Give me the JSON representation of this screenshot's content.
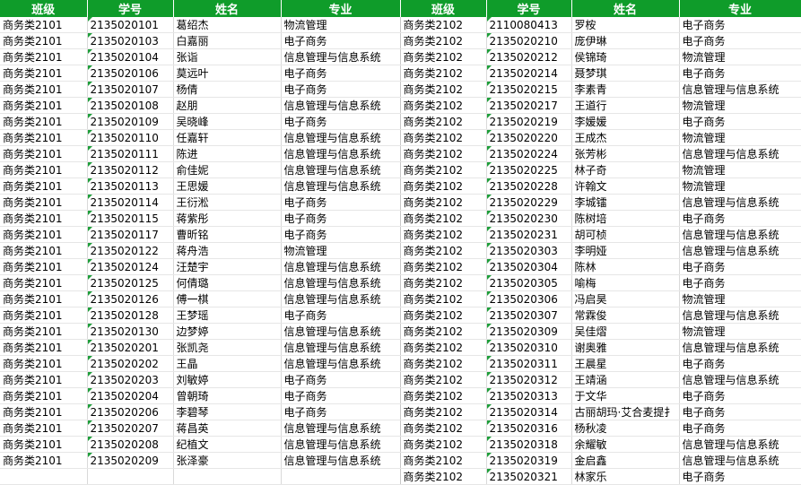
{
  "headers": [
    "班级",
    "学号",
    "姓名",
    "专业",
    "班级",
    "学号",
    "姓名",
    "专业"
  ],
  "colors": {
    "header_bg": "#0f9c2a",
    "header_text": "#ffffff",
    "id_marker": "#1e9e3a"
  },
  "rows": [
    [
      "商务类2101",
      "2135020101",
      "葛绍杰",
      "物流管理",
      "商务类2102",
      "2110080413",
      "罗桉",
      "电子商务"
    ],
    [
      "商务类2101",
      "2135020103",
      "白嘉丽",
      "电子商务",
      "商务类2102",
      "2135020210",
      "庞伊琳",
      "电子商务"
    ],
    [
      "商务类2101",
      "2135020104",
      "张诣",
      "信息管理与信息系统",
      "商务类2102",
      "2135020212",
      "侯锦琦",
      "物流管理"
    ],
    [
      "商务类2101",
      "2135020106",
      "莫远叶",
      "电子商务",
      "商务类2102",
      "2135020214",
      "聂梦琪",
      "电子商务"
    ],
    [
      "商务类2101",
      "2135020107",
      "杨倩",
      "电子商务",
      "商务类2102",
      "2135020215",
      "李素青",
      "信息管理与信息系统"
    ],
    [
      "商务类2101",
      "2135020108",
      "赵朋",
      "信息管理与信息系统",
      "商务类2102",
      "2135020217",
      "王道行",
      "物流管理"
    ],
    [
      "商务类2101",
      "2135020109",
      "吴晓峰",
      "电子商务",
      "商务类2102",
      "2135020219",
      "李媛媛",
      "电子商务"
    ],
    [
      "商务类2101",
      "2135020110",
      "任嘉轩",
      "信息管理与信息系统",
      "商务类2102",
      "2135020220",
      "王成杰",
      "物流管理"
    ],
    [
      "商务类2101",
      "2135020111",
      "陈进",
      "信息管理与信息系统",
      "商务类2102",
      "2135020224",
      "张芳彬",
      "信息管理与信息系统"
    ],
    [
      "商务类2101",
      "2135020112",
      "俞佳妮",
      "信息管理与信息系统",
      "商务类2102",
      "2135020225",
      "林子奇",
      "物流管理"
    ],
    [
      "商务类2101",
      "2135020113",
      "王思媛",
      "信息管理与信息系统",
      "商务类2102",
      "2135020228",
      "许翰文",
      "物流管理"
    ],
    [
      "商务类2101",
      "2135020114",
      "王衍淞",
      "电子商务",
      "商务类2102",
      "2135020229",
      "李城镭",
      "信息管理与信息系统"
    ],
    [
      "商务类2101",
      "2135020115",
      "蒋紫彤",
      "电子商务",
      "商务类2102",
      "2135020230",
      "陈树培",
      "电子商务"
    ],
    [
      "商务类2101",
      "2135020117",
      "曹昕铭",
      "电子商务",
      "商务类2102",
      "2135020231",
      "胡可桢",
      "信息管理与信息系统"
    ],
    [
      "商务类2101",
      "2135020122",
      "蒋舟浩",
      "物流管理",
      "商务类2102",
      "2135020303",
      "李明娅",
      "信息管理与信息系统"
    ],
    [
      "商务类2101",
      "2135020124",
      "汪楚宇",
      "信息管理与信息系统",
      "商务类2102",
      "2135020304",
      "陈林",
      "电子商务"
    ],
    [
      "商务类2101",
      "2135020125",
      "何倩璐",
      "信息管理与信息系统",
      "商务类2102",
      "2135020305",
      "喻梅",
      "电子商务"
    ],
    [
      "商务类2101",
      "2135020126",
      "傅一棋",
      "信息管理与信息系统",
      "商务类2102",
      "2135020306",
      "冯启昊",
      "物流管理"
    ],
    [
      "商务类2101",
      "2135020128",
      "王梦瑶",
      "电子商务",
      "商务类2102",
      "2135020307",
      "常霖俊",
      "信息管理与信息系统"
    ],
    [
      "商务类2101",
      "2135020130",
      "边梦婷",
      "信息管理与信息系统",
      "商务类2102",
      "2135020309",
      "吴佳熠",
      "物流管理"
    ],
    [
      "商务类2101",
      "2135020201",
      "张凯尧",
      "信息管理与信息系统",
      "商务类2102",
      "2135020310",
      "谢奥雅",
      "信息管理与信息系统"
    ],
    [
      "商务类2101",
      "2135020202",
      "王晶",
      "信息管理与信息系统",
      "商务类2102",
      "2135020311",
      "王晨星",
      "电子商务"
    ],
    [
      "商务类2101",
      "2135020203",
      "刘敏婷",
      "电子商务",
      "商务类2102",
      "2135020312",
      "王靖涵",
      "信息管理与信息系统"
    ],
    [
      "商务类2101",
      "2135020204",
      "曾朝琦",
      "电子商务",
      "商务类2102",
      "2135020313",
      "于文华",
      "电子商务"
    ],
    [
      "商务类2101",
      "2135020206",
      "李碧琴",
      "电子商务",
      "商务类2102",
      "2135020314",
      "古丽胡玛·艾合麦提扌",
      "电子商务"
    ],
    [
      "商务类2101",
      "2135020207",
      "蒋昌英",
      "信息管理与信息系统",
      "商务类2102",
      "2135020316",
      "杨秋凌",
      "电子商务"
    ],
    [
      "商务类2101",
      "2135020208",
      "纪植文",
      "信息管理与信息系统",
      "商务类2102",
      "2135020318",
      "余耀敏",
      "信息管理与信息系统"
    ],
    [
      "商务类2101",
      "2135020209",
      "张泽豪",
      "信息管理与信息系统",
      "商务类2102",
      "2135020319",
      "金启鑫",
      "信息管理与信息系统"
    ],
    [
      "",
      "",
      "",
      "",
      "商务类2102",
      "2135020321",
      "林家乐",
      "电子商务"
    ]
  ]
}
